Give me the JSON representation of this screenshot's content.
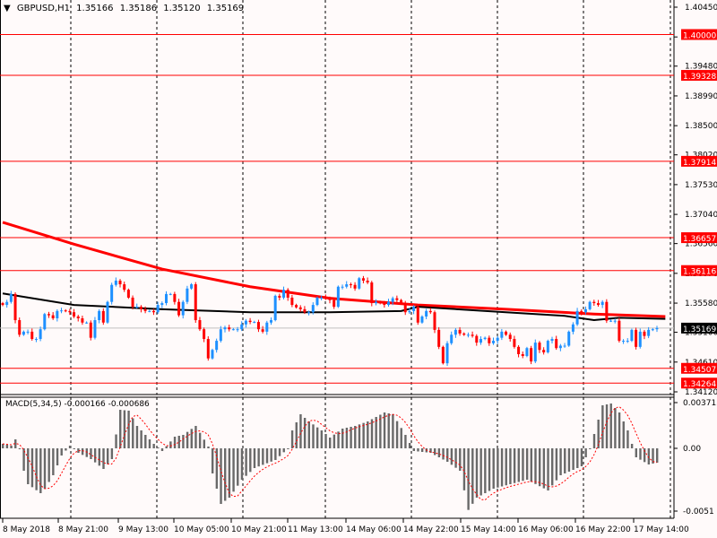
{
  "header": {
    "symbol": "GBPUSD,H1",
    "open": "1.35166",
    "high": "1.35186",
    "low": "1.35120",
    "close": "1.35169"
  },
  "macd_header": {
    "label": "MACD(5,34,5)",
    "main": "-0.000166",
    "signal": "-0.000686"
  },
  "colors": {
    "bull": "#1e90ff",
    "bear": "#ff0000",
    "ma_slow": "#ff0000",
    "ma_fast": "#000000",
    "level": "#ff0000",
    "bid": "#c0c0c0",
    "histogram": "#696969",
    "signal": "#ff0000",
    "background": "#fffafa"
  },
  "chart_data": [
    {
      "type": "candlestick",
      "title": "GBPUSD,H1",
      "ylim": [
        1.3412,
        1.4045
      ],
      "y_ticks": [
        "1.40450",
        "1.39960",
        "1.39480",
        "1.38990",
        "1.38500",
        "1.38020",
        "1.37530",
        "1.37040",
        "1.36560",
        "1.36070",
        "1.35580",
        "1.35100",
        "1.34610",
        "1.34120"
      ],
      "x_tick_labels": [
        "8 May 2018",
        "8 May 21:00",
        "9 May 13:00",
        "10 May 05:00",
        "10 May 21:00",
        "11 May 13:00",
        "14 May 06:00",
        "14 May 22:00",
        "15 May 14:00",
        "16 May 06:00",
        "16 May 22:00",
        "17 May 14:00"
      ],
      "closes": [
        1.3555,
        1.356,
        1.3573,
        1.353,
        1.3506,
        1.3511,
        1.3511,
        1.3499,
        1.3499,
        1.3515,
        1.354,
        1.3538,
        1.3533,
        1.3545,
        1.3546,
        1.3545,
        1.3543,
        1.3536,
        1.3533,
        1.3526,
        1.3526,
        1.3501,
        1.353,
        1.3545,
        1.3526,
        1.356,
        1.3588,
        1.3595,
        1.3589,
        1.358,
        1.3567,
        1.3552,
        1.3552,
        1.3548,
        1.3545,
        1.3545,
        1.3543,
        1.3555,
        1.3558,
        1.3573,
        1.3573,
        1.356,
        1.3538,
        1.356,
        1.3582,
        1.3589,
        1.353,
        1.3515,
        1.3499,
        1.3467,
        1.3481,
        1.3496,
        1.3515,
        1.3518,
        1.3515,
        1.3515,
        1.3515,
        1.3523,
        1.3529,
        1.3527,
        1.3527,
        1.3515,
        1.3511,
        1.3526,
        1.353,
        1.357,
        1.3567,
        1.358,
        1.3567,
        1.3555,
        1.3551,
        1.3548,
        1.3543,
        1.3543,
        1.3555,
        1.3567,
        1.3567,
        1.3566,
        1.3563,
        1.3552,
        1.3585,
        1.3585,
        1.3589,
        1.3588,
        1.3582,
        1.3599,
        1.3595,
        1.3592,
        1.3558,
        1.356,
        1.3558,
        1.3555,
        1.356,
        1.3566,
        1.3563,
        1.3558,
        1.3543,
        1.3545,
        1.3552,
        1.3526,
        1.3536,
        1.3545,
        1.3543,
        1.3514,
        1.3486,
        1.3459,
        1.3492,
        1.3506,
        1.3514,
        1.3508,
        1.3506,
        1.3506,
        1.3504,
        1.3493,
        1.3499,
        1.3501,
        1.3492,
        1.3496,
        1.3501,
        1.3511,
        1.3506,
        1.3499,
        1.3486,
        1.3474,
        1.3471,
        1.3484,
        1.3462,
        1.3493,
        1.3481,
        1.3477,
        1.3496,
        1.3499,
        1.3484,
        1.3488,
        1.3488,
        1.3511,
        1.3523,
        1.3545,
        1.3543,
        1.3548,
        1.356,
        1.3558,
        1.3555,
        1.356,
        1.3529,
        1.3529,
        1.3529,
        1.3496,
        1.3496,
        1.3496,
        1.3514,
        1.3486,
        1.3511,
        1.3504,
        1.3514,
        1.3515,
        1.3517
      ],
      "ma_slow": [
        [
          0,
          1.3691
        ],
        [
          17,
          1.3655
        ],
        [
          38,
          1.3614
        ],
        [
          59,
          1.3585
        ],
        [
          78,
          1.3566
        ],
        [
          99,
          1.3555
        ],
        [
          120,
          1.3548
        ],
        [
          141,
          1.354
        ],
        [
          158,
          1.3536
        ]
      ],
      "ma_fast": [
        [
          0,
          1.3574
        ],
        [
          17,
          1.3555
        ],
        [
          38,
          1.3548
        ],
        [
          59,
          1.3543
        ],
        [
          78,
          1.3543
        ],
        [
          95,
          1.3545
        ],
        [
          99,
          1.3552
        ],
        [
          120,
          1.3543
        ],
        [
          134,
          1.3537
        ],
        [
          141,
          1.353
        ],
        [
          147,
          1.3534
        ],
        [
          158,
          1.3532
        ]
      ],
      "levels": [
        "1.40000",
        "1.39328",
        "1.37914",
        "1.36657",
        "1.36116",
        "1.34507",
        "1.34264"
      ],
      "bid": "1.35169"
    },
    {
      "type": "bar",
      "title": "MACD(5,34,5)",
      "ylim": [
        -0.0051,
        0.003713
      ],
      "y_ticks": [
        "0.003713",
        "0.00",
        "-0.0051"
      ],
      "histogram_keypoints": [
        [
          0,
          0.000364
        ],
        [
          2,
          0.000218
        ],
        [
          3,
          0.000728
        ],
        [
          4,
          0
        ],
        [
          5,
          -0.00182
        ],
        [
          6,
          -0.002912
        ],
        [
          9,
          -0.00364
        ],
        [
          10,
          -0.003276
        ],
        [
          12,
          -0.002184
        ],
        [
          14,
          -0.000582
        ],
        [
          16,
          0.000218
        ],
        [
          18,
          -0.000364
        ],
        [
          21,
          -0.000874
        ],
        [
          24,
          -0.001674
        ],
        [
          26,
          -0.000874
        ],
        [
          28,
          0.00313
        ],
        [
          30,
          0.003058
        ],
        [
          32,
          0.00182
        ],
        [
          36,
          0.000364
        ],
        [
          38,
          -0.000218
        ],
        [
          41,
          0.000946
        ],
        [
          43,
          0.001092
        ],
        [
          46,
          0.00182
        ],
        [
          49,
          0.000146
        ],
        [
          50,
          -0.002038
        ],
        [
          52,
          -0.004514
        ],
        [
          54,
          -0.004004
        ],
        [
          57,
          -0.002548
        ],
        [
          60,
          -0.001602
        ],
        [
          65,
          -0.000946
        ],
        [
          68,
          0
        ],
        [
          69,
          0.001456
        ],
        [
          71,
          0.002766
        ],
        [
          73,
          0.002184
        ],
        [
          76,
          0.001456
        ],
        [
          78,
          0.000874
        ],
        [
          81,
          0.001602
        ],
        [
          84,
          0.00182
        ],
        [
          87,
          0.002184
        ],
        [
          91,
          0.002912
        ],
        [
          93,
          0.002766
        ],
        [
          96,
          0.001092
        ],
        [
          98,
          -0.000218
        ],
        [
          102,
          -0.000364
        ],
        [
          106,
          -0.001092
        ],
        [
          109,
          -0.00182
        ],
        [
          111,
          -0.005
        ],
        [
          113,
          -0.004004
        ],
        [
          117,
          -0.003276
        ],
        [
          121,
          -0.002912
        ],
        [
          125,
          -0.002548
        ],
        [
          130,
          -0.003422
        ],
        [
          133,
          -0.002184
        ],
        [
          138,
          -0.001456
        ],
        [
          140,
          0
        ],
        [
          143,
          0.003494
        ],
        [
          145,
          0.00364
        ],
        [
          147,
          0.002912
        ],
        [
          149,
          0.001456
        ],
        [
          151,
          -0.000728
        ],
        [
          154,
          -0.00131
        ],
        [
          157,
          -0.001092
        ],
        [
          158,
          -0.000166
        ]
      ]
    }
  ]
}
